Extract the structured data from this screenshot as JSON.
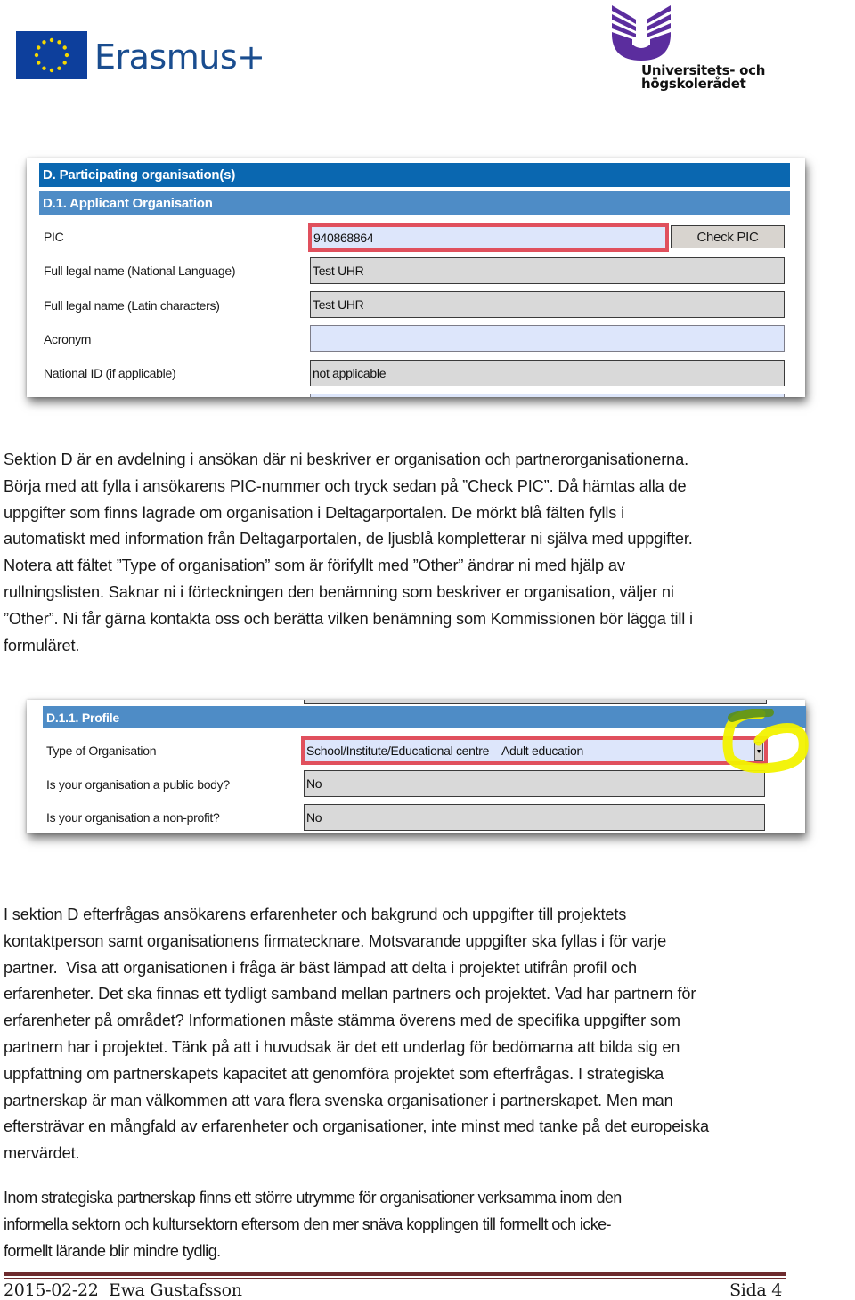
{
  "logos": {
    "erasmus": {
      "text": "Erasmus+",
      "color": "#1a4d8f",
      "flag_color": "#0d3f9c",
      "star_color": "#f5d800"
    },
    "uhr": {
      "line1": "Universitets- och",
      "line2": "högskolerådet",
      "color": "#5b2d9e"
    }
  },
  "form1": {
    "section_title": "D. Participating organisation(s)",
    "subsection_title": "D.1. Applicant Organisation",
    "colors": {
      "section_bar": "#0a67b0",
      "subsection_bar": "#4e8cc6",
      "highlight": "#e0505d",
      "filled_field": "#d9d9d9",
      "editable_field": "#dde6fb"
    },
    "fields": [
      {
        "label": "PIC",
        "value": "940868864",
        "state": "editable-highlighted"
      },
      {
        "label": "Full legal name (National Language)",
        "value": "Test UHR",
        "state": "filled"
      },
      {
        "label": "Full legal name (Latin characters)",
        "value": "Test UHR",
        "state": "filled"
      },
      {
        "label": "Acronym",
        "value": "",
        "state": "editable"
      },
      {
        "label": "National ID (if applicable)",
        "value": "not applicable",
        "state": "filled"
      }
    ],
    "check_button": "Check PIC"
  },
  "paragraph1": [
    "Sektion D är en avdelning i ansökan där ni beskriver er organisation och partnerorganisationerna.",
    "Börja med att fylla i ansökarens PIC-nummer och tryck sedan på ”Check PIC”. Då hämtas alla de",
    "uppgifter som finns lagrade om organisation i Deltagarportalen. De mörkt blå fälten fylls i",
    "automatiskt med information från Deltagarportalen, de ljusblå kompletterar ni själva med uppgifter.",
    "Notera att fältet ”Type of organisation” som är förifyllt med ”Other” ändrar ni med hjälp av",
    "rullningslisten. Saknar ni i förteckningen den benämning som beskriver er organisation, väljer ni",
    "”Other”. Ni får gärna kontakta oss och berätta vilken benämning som Kommissionen bör lägga till i",
    "formuläret."
  ],
  "form2": {
    "subsection_title": "D.1.1. Profile",
    "fields": [
      {
        "label": "Type of Organisation",
        "value": "School/Institute/Educational centre – Adult education",
        "state": "dropdown-highlighted"
      },
      {
        "label": "Is your organisation a public body?",
        "value": "No",
        "state": "filled"
      },
      {
        "label": "Is your organisation a non-profit?",
        "value": "No",
        "state": "filled"
      }
    ],
    "annotation_color": "#f2f200"
  },
  "paragraph2": [
    "I sektion D efterfrågas ansökarens erfarenheter och bakgrund och uppgifter till projektets",
    "kontaktperson samt organisationens firmatecknare. Motsvarande uppgifter ska fyllas i för varje",
    "partner.  Visa att organisationen i fråga är bäst lämpad att delta i projektet utifrån profil och",
    "erfarenheter. Det ska finnas ett tydligt samband mellan partners och projektet. Vad har partnern för",
    "erfarenheter på området? Informationen måste stämma överens med de specifika uppgifter som",
    "partnern har i projektet. Tänk på att i huvudsak är det ett underlag för bedömarna att bilda sig en",
    "uppfattning om partnerskapets kapacitet att genomföra projektet som efterfrågas. I strategiska",
    "partnerskap är man välkommen att vara flera svenska organisationer i partnerskapet. Men man",
    "eftersträvar en mångfald av erfarenheter och organisationer, inte minst med tanke på det europeiska",
    "mervärdet."
  ],
  "paragraph3": [
    "Inom strategiska partnerskap finns ett större utrymme för organisationer verksamma inom den",
    "informella sektorn och kultursektorn eftersom den mer snäva kopplingen till formellt och icke-",
    "formellt lärande blir mindre tydlig."
  ],
  "footer": {
    "left": "2015-02-22  Ewa Gustafsson",
    "right": "Sida 4",
    "rule_color": "#6e2b2e"
  }
}
